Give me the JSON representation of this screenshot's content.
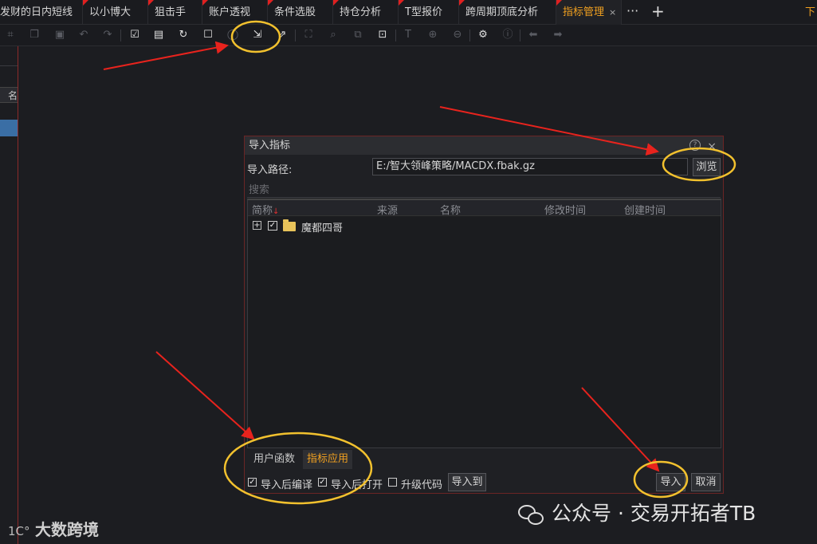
{
  "tabs": [
    {
      "label": "发财的日内短线",
      "active": false
    },
    {
      "label": "以小博大",
      "active": false
    },
    {
      "label": "狙击手",
      "active": false
    },
    {
      "label": "账户透视",
      "active": false
    },
    {
      "label": "条件选股",
      "active": false
    },
    {
      "label": "持仓分析",
      "active": false
    },
    {
      "label": "T型报价",
      "active": false
    },
    {
      "label": "跨周期顶底分析",
      "active": false
    },
    {
      "label": "指标管理",
      "active": true
    }
  ],
  "tab_close": "×",
  "tab_more": "···",
  "tab_add": "+",
  "tab_cut_text": "下",
  "toolbar": {
    "icons": [
      "crop-icon",
      "copy-icon",
      "paste-icon",
      "undo-icon",
      "redo-icon",
      "check-square-icon",
      "save-check-icon",
      "refresh-check-icon",
      "dotted-check-icon",
      "circle-icon",
      "import-icon",
      "export-icon",
      "fit-icon",
      "search-icon",
      "compare-icon",
      "find-icon",
      "text-icon",
      "zoom-in-icon",
      "zoom-out-icon",
      "settings-icon",
      "info-icon",
      "arrow-left-icon",
      "arrow-right-icon"
    ]
  },
  "left_panel": {
    "header_text": "名称"
  },
  "dialog": {
    "title": "导入指标",
    "help": "?",
    "close": "×",
    "path_label": "导入路径:",
    "path_value": "E:/智大领峰策略/MACDX.fbak.gz",
    "browse_label": "浏览",
    "search_placeholder": "搜索",
    "columns": [
      "简称",
      "来源",
      "名称",
      "修改时间",
      "创建时间"
    ],
    "rows": [
      {
        "label": "魔都四哥",
        "checked": true,
        "expander": "+"
      }
    ],
    "bottom_tabs": {
      "user_functions": "用户函数",
      "indicator_apps": "指标应用"
    },
    "options": {
      "compile_after_import": {
        "label": "导入后编译",
        "checked": true
      },
      "open_after_import": {
        "label": "导入后打开",
        "checked": true
      },
      "upgrade_code": {
        "label": "升级代码",
        "checked": false
      }
    },
    "import_to_label": "导入到",
    "import_label": "导入",
    "cancel_label": "取消"
  },
  "watermarks": {
    "left_logo": "1C°",
    "left_text": "大数跨境",
    "right_text": "公众号 · 交易开拓者TB"
  },
  "colors": {
    "accent": "#f0a020",
    "annotation_red": "#e8231d",
    "annotation_yellow": "#f2c12e",
    "selection_blue": "#3a6ea5"
  }
}
